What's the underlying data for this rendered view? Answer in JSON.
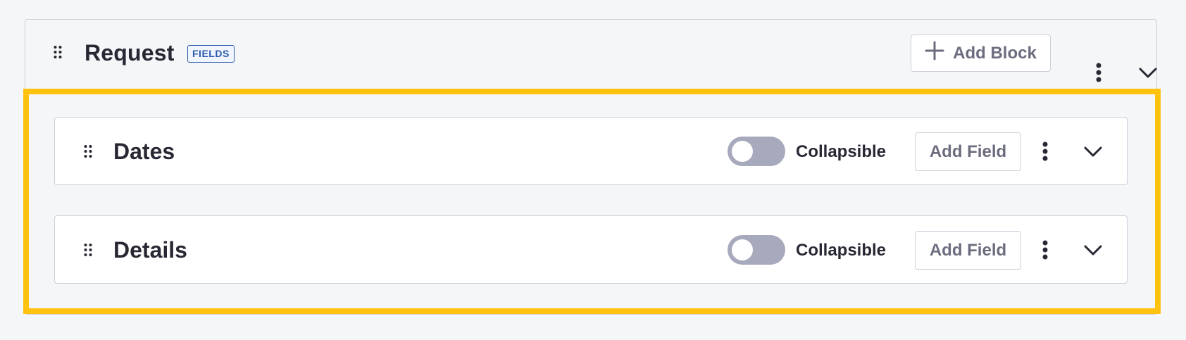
{
  "header": {
    "title": "Request",
    "badge": "FIELDS",
    "add_block_label": "Add Block"
  },
  "blocks": [
    {
      "title": "Dates",
      "toggle_label": "Collapsible",
      "toggle_on": false,
      "add_field_label": "Add Field"
    },
    {
      "title": "Details",
      "toggle_label": "Collapsible",
      "toggle_on": false,
      "add_field_label": "Add Field"
    }
  ],
  "colors": {
    "highlight": "#ffc20e",
    "badge": "#2e5aac",
    "toggle_off": "#a7a9bc"
  },
  "icons": {
    "drag": "drag-handle-icon",
    "plus": "plus-icon",
    "kebab": "ellipsis-v-icon",
    "chevron": "chevron-down-icon"
  }
}
